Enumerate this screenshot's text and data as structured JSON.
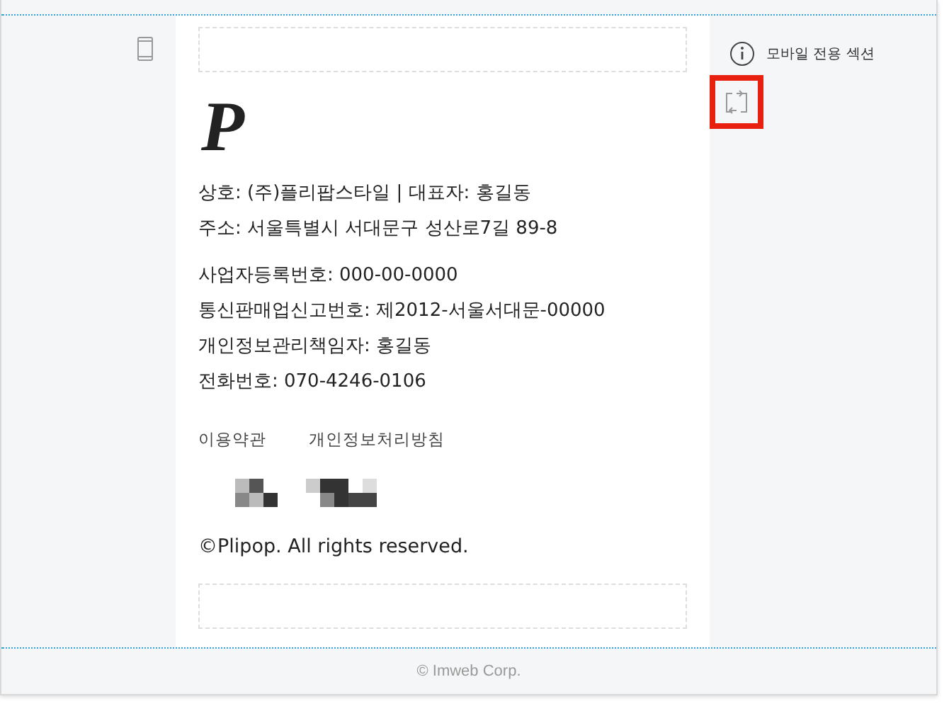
{
  "side_panel": {
    "label": "모바일 전용 섹션"
  },
  "logo": {
    "text": "P"
  },
  "company_info": [
    {
      "lines": [
        "상호: (주)플리팝스타일 | 대표자: 홍길동",
        "주소: 서울특별시 서대문구 성산로7길 89-8"
      ]
    },
    {
      "lines": [
        "사업자등록번호: 000-00-0000",
        "통신판매업신고번호: 제2012-서울서대문-00000",
        "개인정보관리책임자: 홍길동",
        "전화번호: 070-4246-0106"
      ]
    }
  ],
  "links": [
    "이용약관",
    "개인정보처리방침"
  ],
  "copyright": "©Plipop. All rights reserved.",
  "footer": "© Imweb Corp."
}
